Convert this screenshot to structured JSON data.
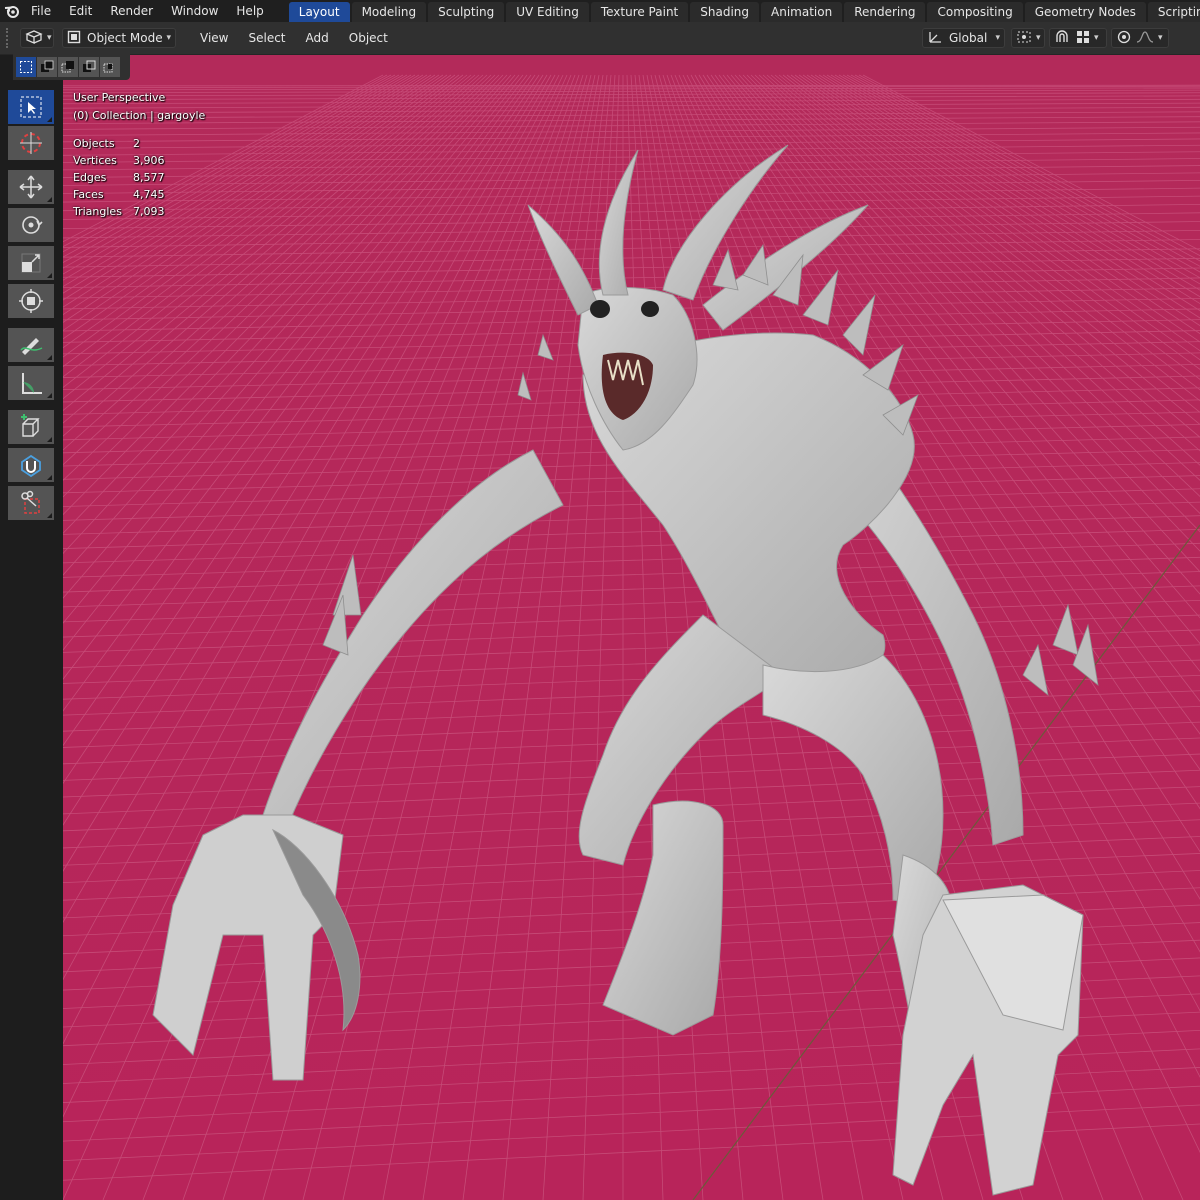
{
  "menubar": {
    "items": [
      "File",
      "Edit",
      "Render",
      "Window",
      "Help"
    ]
  },
  "workspace_tabs": {
    "items": [
      "Layout",
      "Modeling",
      "Sculpting",
      "UV Editing",
      "Texture Paint",
      "Shading",
      "Animation",
      "Rendering",
      "Compositing",
      "Geometry Nodes",
      "Scripting"
    ],
    "active": "Layout",
    "add_label": "+"
  },
  "header": {
    "mode": "Object Mode",
    "menus": [
      "View",
      "Select",
      "Add",
      "Object"
    ],
    "transform_orientation": "Global"
  },
  "overlay": {
    "view_name": "User Perspective",
    "collection": "(0) Collection | gargoyle",
    "stats": [
      {
        "label": "Objects",
        "value": "2"
      },
      {
        "label": "Vertices",
        "value": "3,906"
      },
      {
        "label": "Edges",
        "value": "8,577"
      },
      {
        "label": "Faces",
        "value": "4,745"
      },
      {
        "label": "Triangles",
        "value": "7,093"
      }
    ]
  },
  "toolbar": {
    "tools": [
      "select-box-icon",
      "cursor-icon",
      "move-icon",
      "rotate-icon",
      "scale-icon",
      "transform-icon",
      "annotate-icon",
      "measure-icon",
      "add-cube-icon",
      "shrink-wrap-icon",
      "knife-icon"
    ],
    "active": "select-box-icon"
  },
  "colors": {
    "viewport_bg": "#b32a5a",
    "active_accent": "#1f4a99",
    "mesh": "#c8c8c8"
  }
}
